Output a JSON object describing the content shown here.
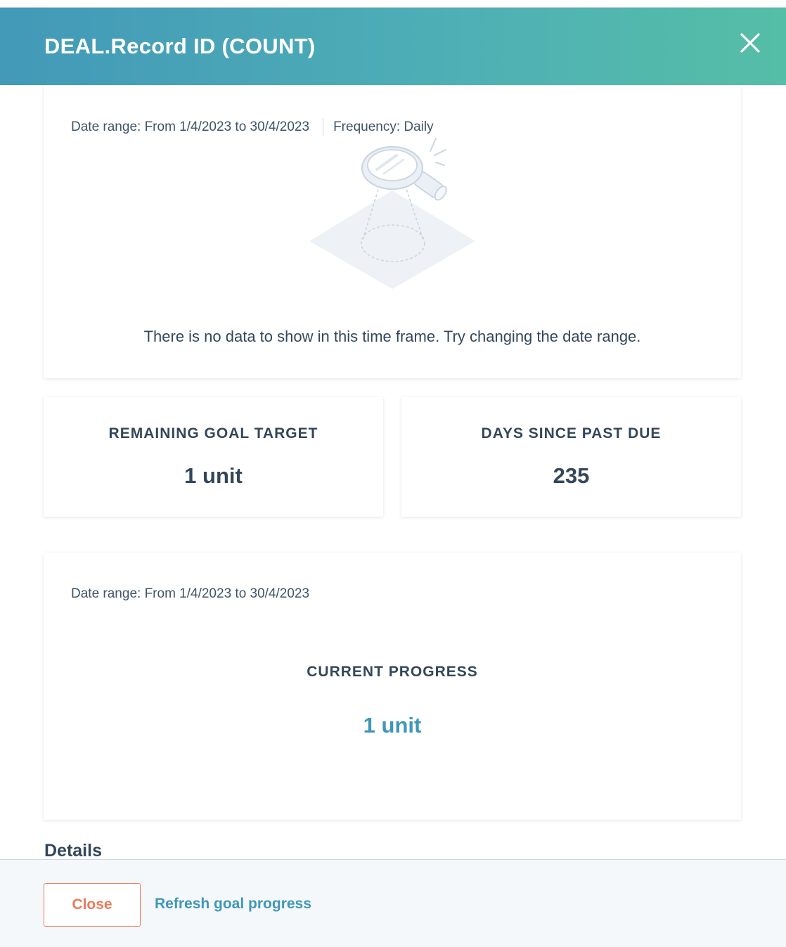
{
  "modal": {
    "title": "DEAL.Record ID (COUNT)"
  },
  "chart_card": {
    "date_range": "Date range: From 1/4/2023 to 30/4/2023",
    "frequency": "Frequency: Daily",
    "empty_message": "There is no data to show in this time frame. Try changing the date range."
  },
  "stats": {
    "remaining": {
      "label": "REMAINING GOAL TARGET",
      "value": "1 unit"
    },
    "days_past_due": {
      "label": "DAYS SINCE PAST DUE",
      "value": "235"
    }
  },
  "progress_card": {
    "date_range": "Date range: From 1/4/2023 to 30/4/2023",
    "label": "CURRENT PROGRESS",
    "value": "1 unit"
  },
  "details": {
    "title": "Details"
  },
  "footer": {
    "close_label": "Close",
    "refresh_label": "Refresh goal progress"
  },
  "icons": {
    "close": "close-icon",
    "empty_state": "magnifying-glass-illustration"
  },
  "colors": {
    "header_start": "#4299b8",
    "header_end": "#55bea6",
    "accent_link": "#3f97b8",
    "close_button": "#ea7b5c",
    "text": "#33475b"
  }
}
